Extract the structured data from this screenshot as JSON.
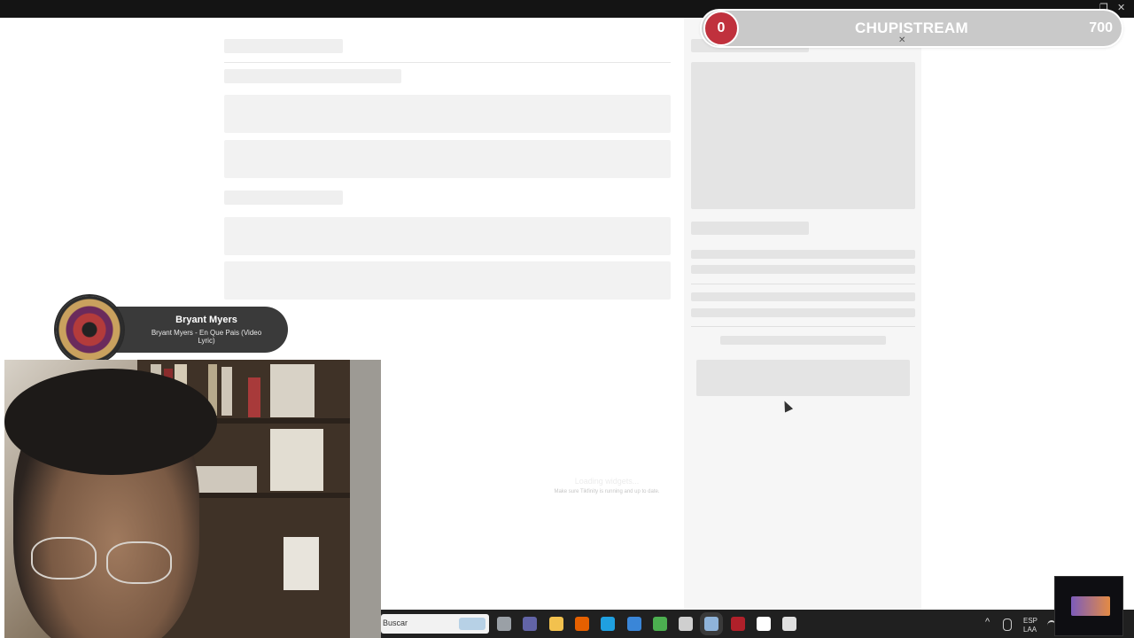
{
  "window": {
    "restore_icon": "restore-icon",
    "close_icon": "close-icon",
    "close_glyph": "✕",
    "restore_glyph": "❐"
  },
  "counter_widget": {
    "current": "0",
    "title": "CHUPISTREAM",
    "goal": "700",
    "close_glyph": "✕",
    "accent_color": "#c0313d"
  },
  "now_playing": {
    "artist": "Bryant Myers",
    "track": "Bryant Myers - En Que Pais (Video Lyric)"
  },
  "loading_message": {
    "title": "Loading widgets...",
    "subtitle": "Make sure Tikfinity is running and up to date."
  },
  "taskbar": {
    "search_placeholder": "Buscar",
    "apps": [
      {
        "name": "task-view-icon",
        "color": "#9aa0a6"
      },
      {
        "name": "teams-icon",
        "color": "#6264a7"
      },
      {
        "name": "file-explorer-icon",
        "color": "#f2c14e"
      },
      {
        "name": "firefox-icon",
        "color": "#e66000"
      },
      {
        "name": "edge-icon",
        "color": "#1fa0e0"
      },
      {
        "name": "mail-icon",
        "color": "#3a86d8"
      },
      {
        "name": "chrome-icon",
        "color": "#4caf50"
      },
      {
        "name": "steam-helper-icon",
        "color": "#cfcfcf"
      },
      {
        "name": "steam-icon",
        "color": "#8fb3d9"
      },
      {
        "name": "red-app-icon",
        "color": "#b0202a"
      },
      {
        "name": "tiktok-icon",
        "color": "#ffffff"
      },
      {
        "name": "epic-games-icon",
        "color": "#e0e0e0"
      }
    ],
    "tray": {
      "chevron": "^",
      "lang_top": "ESP",
      "lang_bottom": "LAA"
    }
  }
}
